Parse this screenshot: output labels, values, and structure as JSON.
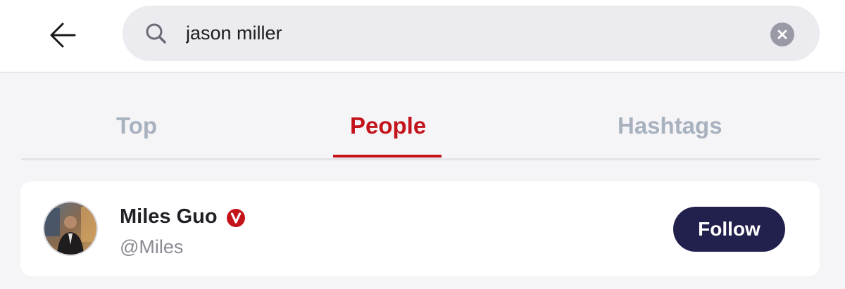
{
  "header": {
    "back_icon": "arrow-left-icon",
    "search": {
      "icon": "search-icon",
      "value": "jason miller",
      "clear_icon": "close-icon"
    }
  },
  "tabs": [
    {
      "label": "Top",
      "active": false
    },
    {
      "label": "People",
      "active": true
    },
    {
      "label": "Hashtags",
      "active": false
    }
  ],
  "results": [
    {
      "name": "Miles Guo",
      "handle": "@Miles",
      "verified_icon": "verified-v-badge-icon",
      "follow_label": "Follow"
    }
  ],
  "colors": {
    "accent": "#c4141b",
    "inactive_tab": "#a8b1be",
    "follow_button": "#22214d",
    "background": "#f5f5f8"
  }
}
